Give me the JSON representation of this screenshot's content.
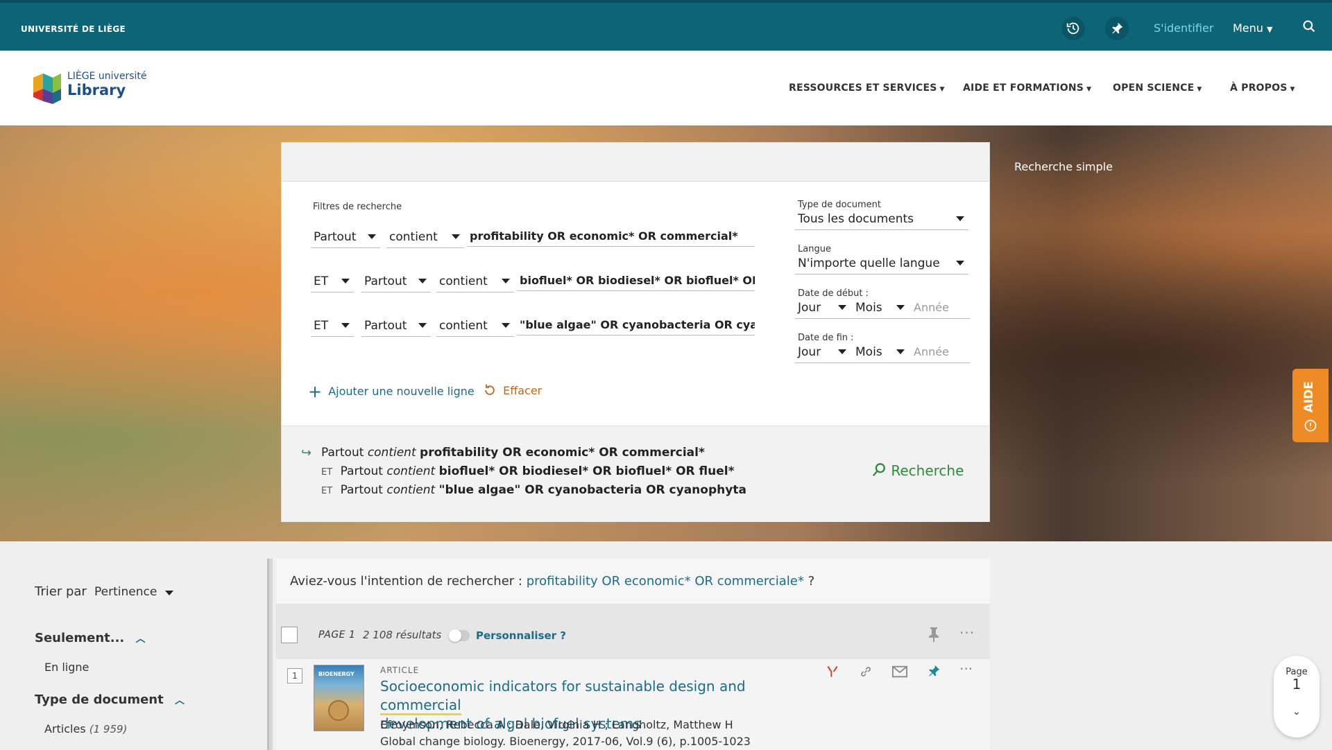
{
  "topbar": {
    "university": "UNIVERSITÉ DE LIÈGE",
    "signin": "S'identifier",
    "menu": "Menu"
  },
  "header": {
    "logo_top": "LIÈGE université",
    "logo_bottom": "Library",
    "nav": [
      "RESSOURCES ET SERVICES",
      "AIDE ET FORMATIONS",
      "OPEN SCIENCE",
      "À PROPOS"
    ]
  },
  "hero": {
    "simple_search": "Recherche simple"
  },
  "filters": {
    "title": "Filtres de recherche",
    "row1": {
      "field": "Partout",
      "operator": "contient",
      "query": "profitability OR economic* OR commercial*"
    },
    "row2": {
      "bool": "ET",
      "field": "Partout",
      "operator": "contient",
      "query": "biofluel* OR biodiesel* OR biofluel* OR flue"
    },
    "row3": {
      "bool": "ET",
      "field": "Partout",
      "operator": "contient",
      "query": "\"blue algae\" OR cyanobacteria OR cyanoph"
    },
    "add_line": "Ajouter une nouvelle ligne",
    "clear": "Effacer",
    "doc_type_label": "Type de document",
    "doc_type_value": "Tous les documents",
    "lang_label": "Langue",
    "lang_value": "N'importe quelle langue",
    "start_label": "Date de début :",
    "end_label": "Date de fin :",
    "day": "Jour",
    "month": "Mois",
    "year_placeholder": "Année"
  },
  "summary": {
    "row1": {
      "field": "Partout",
      "op": "contient",
      "q": "profitability OR economic* OR commercial*"
    },
    "row2": {
      "bool": "ET",
      "field": "Partout",
      "op": "contient",
      "q": "biofluel* OR biodiesel* OR biofluel* OR fluel*"
    },
    "row3": {
      "bool": "ET",
      "field": "Partout",
      "op": "contient",
      "q": "\"blue algae\" OR cyanobacteria OR cyanophyta"
    },
    "search_button": "Recherche"
  },
  "sidebar": {
    "sort_label": "Trier par",
    "sort_value": "Pertinence",
    "only_heading": "Seulement...",
    "only_item": "En ligne",
    "doctype_heading": "Type de document",
    "articles": "Articles",
    "articles_count": "(1 959)"
  },
  "results": {
    "didyoumean_prefix": "Aviez-vous l'intention de rechercher : ",
    "didyoumean_link": "profitability OR economic* OR commerciale*",
    "didyoumean_suffix": " ?",
    "page_label": "PAGE 1",
    "count": "2 108 résultats",
    "personalize": "Personnaliser ?",
    "item": {
      "index": "1",
      "type": "ARTICLE",
      "thumb_text": "BIOENERGY",
      "title_a": "Socioeconomic indicators for sustainable design and ",
      "title_highlight": "commercial",
      "title_b": "development of algal biofuel systems",
      "authors": "Efroymson, Rebecca A ; Dale, Virginia H ; Langholtz, Matthew H",
      "source": "Global change biology. Bioenergy, 2017-06, Vol.9 (6), p.1005-1023"
    }
  },
  "aide": "AIDE",
  "pager": {
    "label": "Page",
    "number": "1"
  }
}
